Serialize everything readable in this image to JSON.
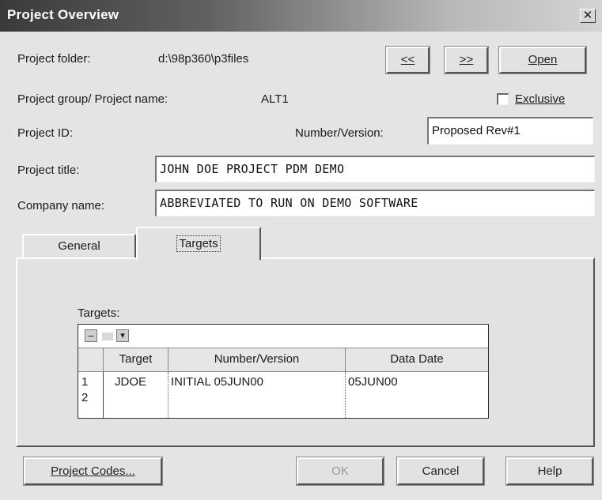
{
  "window": {
    "title": "Project Overview",
    "close_label": "✕"
  },
  "header": {
    "project_folder_label": "Project folder:",
    "project_folder_value": "d:\\98p360\\p3files",
    "prev_label": "<<",
    "next_label": ">>",
    "open_label": "Open",
    "group_label": "Project group/ Project name:",
    "group_value": "ALT1",
    "exclusive_label": "Exclusive",
    "exclusive_checked": false,
    "project_id_label": "Project ID:",
    "number_version_label": "Number/Version:",
    "number_version_value": "Proposed Rev#1",
    "project_title_label": "Project title:",
    "project_title_value": "JOHN DOE PROJECT PDM DEMO",
    "company_label": "Company name:",
    "company_value": "ABBREVIATED TO RUN ON DEMO SOFTWARE"
  },
  "tabs": [
    {
      "label": "General",
      "active": false
    },
    {
      "label": "Targets",
      "active": true
    }
  ],
  "targets": {
    "label": "Targets:",
    "toolbar": {
      "minus_label": "–",
      "dropdown_label": "▾"
    },
    "columns": [
      "Target",
      "Number/Version",
      "Data Date"
    ],
    "rows": [
      {
        "num": "1",
        "target": "JDOE",
        "number_version": "INITIAL 05JUN00",
        "data_date": "05JUN00"
      },
      {
        "num": "2",
        "target": "",
        "number_version": "",
        "data_date": ""
      }
    ]
  },
  "footer": {
    "project_codes_label": "Project Codes...",
    "ok_label": "OK",
    "cancel_label": "Cancel",
    "help_label": "Help"
  }
}
